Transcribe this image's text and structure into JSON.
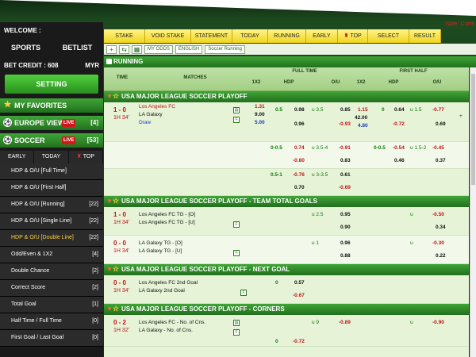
{
  "sidebar": {
    "welcome": "WELCOME :",
    "tabs": [
      "SPORTS",
      "BETLIST"
    ],
    "credit_label": "BET CREDIT : 608",
    "credit_currency": "MYR",
    "setting": "SETTING",
    "sections": [
      {
        "label": "MY FAVORITES",
        "icon": "star-icon",
        "badge": "",
        "count": ""
      },
      {
        "label": "EUROPE VIEW",
        "icon": "soccer-ball-icon",
        "badge": "LIVE",
        "count": "[4]"
      },
      {
        "label": "SOCCER",
        "icon": "soccer-ball-icon",
        "badge": "LIVE",
        "count": "[53]"
      }
    ],
    "subtabs": [
      "EARLY",
      "TODAY",
      "TOP"
    ],
    "items": [
      {
        "label": "HDP & O/U [Full Time]",
        "count": ""
      },
      {
        "label": "HDP & O/U [First Half]",
        "count": ""
      },
      {
        "label": "HDP & O/U [Running]",
        "count": "[22]"
      },
      {
        "label": "HDP & O/U [Single Line]",
        "count": "[22]"
      },
      {
        "label": "HDP & O/U [Double Line]",
        "count": "[22]"
      },
      {
        "label": "Odd/Even & 1X2",
        "count": "[4]"
      },
      {
        "label": "Double Chance",
        "count": "[2]"
      },
      {
        "label": "Correct Score",
        "count": "[2]"
      },
      {
        "label": "Total Goal",
        "count": "[1]"
      },
      {
        "label": "Half Time / Full Time",
        "count": "[0]"
      },
      {
        "label": "First Goal / Last Goal",
        "count": "[0]"
      }
    ]
  },
  "topnav": [
    "STAKE",
    "VOID STAKE",
    "STATEMENT",
    "TODAY",
    "RUNNING",
    "EARLY",
    "TOP",
    "SELECT LEAGUE",
    "RESULT"
  ],
  "note": "Note: Curre",
  "toolbar": {
    "plus": "+",
    "refresh": "⇆",
    "odds": "MY ODDS",
    "language": "ENGLISH",
    "filter": "Soccer Running"
  },
  "section_title": "RUNNING",
  "table_head": {
    "time": "TIME",
    "matches": "MATCHES",
    "full_time": "FULL TIME",
    "first_half": "FIRST HALF",
    "ft_1x2": "1X2",
    "ft_hdp": "HDP",
    "ft_ou": "O/U",
    "fh_1x2": "1X2",
    "fh_hdp": "HDP",
    "fh_ou": "O/U"
  },
  "leagues": [
    {
      "name": "USA MAJOR LEAGUE SOCCER PLAYOFF",
      "rows": [
        {
          "score": "1 - 0",
          "time": "1H 34'",
          "home": "Los Angeles FC",
          "away": "LA Galaxy",
          "draw": "Draw",
          "x1": "1.31",
          "x2": "9.00",
          "xd": "5.00",
          "hdp": "0.5",
          "hdp_h": "0.98",
          "hdp_a": "0.96",
          "ou_line": "u 3.5",
          "ou_o": "0.85",
          "ou_u": "-0.93",
          "fh_x1": "1.15",
          "fh_x2": "42.00",
          "fh_xd": "4.80",
          "fh_hdp": "0",
          "fh_hdp_h": "0.64",
          "fh_hdp_a": "-0.72",
          "fh_ou_line": "u 1.5",
          "fh_ou_o": "-0.77",
          "fh_ou_u": "0.69"
        },
        {
          "hdp": "0-0.5",
          "hdp_h": "0.74",
          "hdp_a": "-0.80",
          "ou_line": "u 3.5-4",
          "ou_o": "-0.91",
          "ou_u": "0.83",
          "fh_hdp": "0-0.5",
          "fh_hdp_h": "-0.54",
          "fh_hdp_a": "0.46",
          "fh_ou_line": "u 1.5-2",
          "fh_ou_o": "-0.45",
          "fh_ou_u": "0.37"
        },
        {
          "hdp": "0.5-1",
          "hdp_h": "-0.76",
          "hdp_a": "0.70",
          "ou_line": "u 3-3.5",
          "ou_o": "0.61",
          "ou_u": "-0.69"
        }
      ]
    },
    {
      "name": "USA MAJOR LEAGUE SOCCER PLAYOFF - TEAM TOTAL GOALS",
      "rows": [
        {
          "score": "1 - 0",
          "time": "1H 34'",
          "home": "Los Angeles FC TG - [O]",
          "away": "Los Angeles FC TG - [U]",
          "ou_line": "u 2.5",
          "ou_o": "0.95",
          "ou_u": "0.90",
          "fh_ou_line": "u",
          "fh_ou_o": "-0.50",
          "fh_ou_u": "0.34"
        },
        {
          "score": "0 - 0",
          "time": "1H 34'",
          "home": "LA Galaxy TG - [O]",
          "away": "LA Galaxy TG - [U]",
          "ou_line": "u 1",
          "ou_o": "0.96",
          "ou_u": "0.88",
          "fh_ou_line": "u",
          "fh_ou_o": "-0.30",
          "fh_ou_u": "0.22"
        }
      ]
    },
    {
      "name": "USA MAJOR LEAGUE SOCCER PLAYOFF - NEXT GOAL",
      "rows": [
        {
          "score": "0 - 0",
          "time": "1H 34'",
          "home": "Los Angeles FC 2nd Goal",
          "away": "LA Galaxy 2nd Goal",
          "hdp": "0",
          "hdp_h": "0.57",
          "hdp_a": "-0.67"
        }
      ]
    },
    {
      "name": "USA MAJOR LEAGUE SOCCER PLAYOFF - CORNERS",
      "rows": [
        {
          "score": "0 - 2",
          "time": "1H 32'",
          "home": "Los Angeles FC - No. of Cns.",
          "away": "LA Galaxy - No. of Cns.",
          "hdp": "0",
          "hdp_h": "-0.72",
          "ou_line": "u 9",
          "ou_o": "-0.89",
          "fh_ou_line": "u",
          "fh_ou_o": "-0.90"
        }
      ]
    }
  ]
}
